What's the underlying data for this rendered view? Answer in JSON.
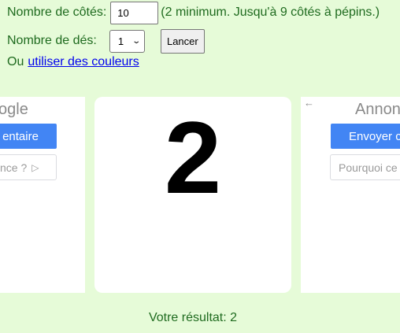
{
  "form": {
    "sides_label": "Nombre de côtés:",
    "sides_value": "10",
    "sides_hint": "(2 minimum. Jusqu'à 9 côtés à pépins.)",
    "dice_label": "Nombre de dés:",
    "dice_value": "1",
    "roll_label": "Lancer",
    "colors_prefix": "Ou",
    "colors_link": "utiliser des couleurs"
  },
  "ads": {
    "left": {
      "brand": "ogle",
      "primary": "entaire",
      "secondary": "nce ?",
      "secondary_icon": "play-outline-icon"
    },
    "right": {
      "back_icon": "back-arrow-icon",
      "brand": "Annonc",
      "primary": "Envoyer c",
      "secondary": "Pourquoi ce"
    }
  },
  "die": {
    "value": "2"
  },
  "result": {
    "text": "Votre résultat: 2"
  }
}
